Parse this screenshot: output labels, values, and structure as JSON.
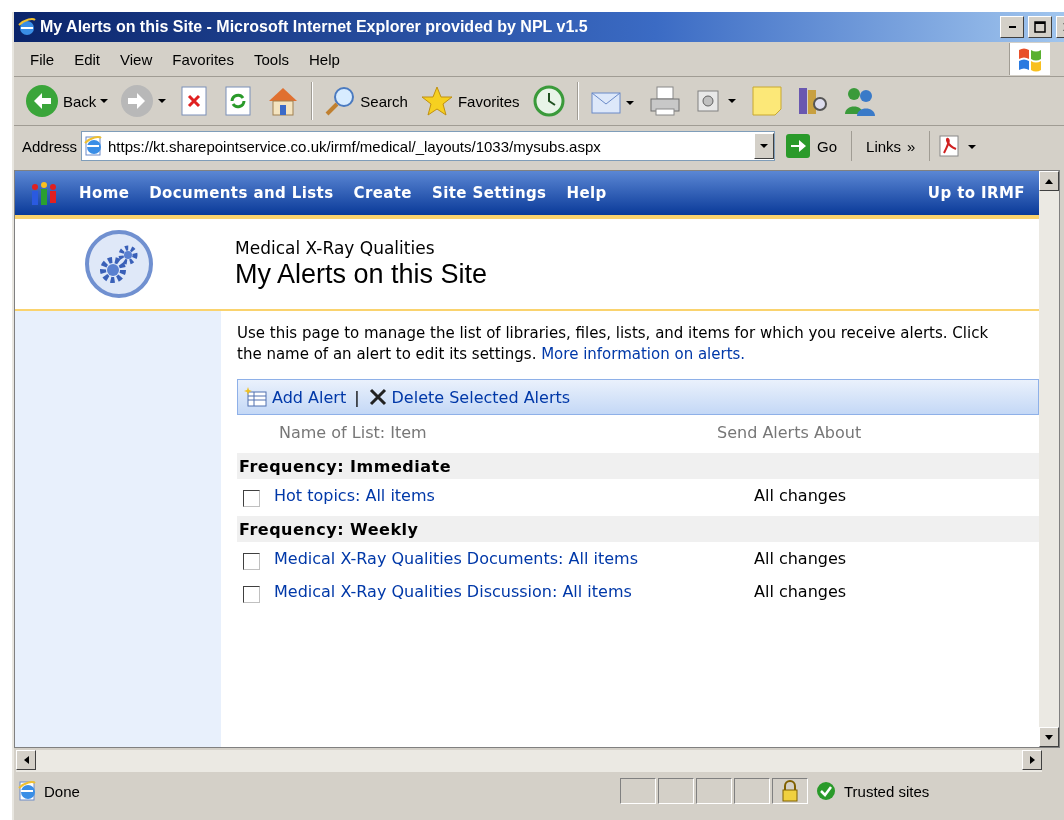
{
  "window": {
    "title": "My Alerts on this Site - Microsoft Internet Explorer provided by NPL v1.5"
  },
  "menu": [
    "File",
    "Edit",
    "View",
    "Favorites",
    "Tools",
    "Help"
  ],
  "toolbar": [
    {
      "kind": "back",
      "label": "Back"
    },
    {
      "kind": "forward"
    },
    {
      "kind": "stop"
    },
    {
      "kind": "refresh"
    },
    {
      "kind": "home"
    },
    {
      "kind": "search",
      "label": "Search"
    },
    {
      "kind": "favorites",
      "label": "Favorites"
    },
    {
      "kind": "history"
    },
    {
      "kind": "mail"
    },
    {
      "kind": "print"
    },
    {
      "kind": "edit"
    },
    {
      "kind": "note"
    },
    {
      "kind": "research"
    },
    {
      "kind": "messenger"
    }
  ],
  "address": {
    "label": "Address",
    "value": "https://kt.sharepointservice.co.uk/irmf/medical/_layouts/1033/mysubs.aspx",
    "go": "Go",
    "links": "Links",
    "chevron": "»"
  },
  "nav": {
    "items": [
      "Home",
      "Documents and Lists",
      "Create",
      "Site Settings",
      "Help"
    ],
    "right": "Up to IRMF"
  },
  "header": {
    "site": "Medical X-Ray Qualities",
    "title": "My Alerts on this Site"
  },
  "intro": {
    "text": "Use this page to manage the list of libraries, files, lists, and items for which you receive alerts. Click the name of an alert to edit its settings.",
    "link": "More information on alerts."
  },
  "actions": [
    {
      "kind": "add",
      "label": "Add Alert"
    },
    {
      "kind": "delete",
      "label": "Delete Selected Alerts"
    }
  ],
  "action_separator": "|",
  "columns": [
    "Name of List: Item",
    "Send Alerts About"
  ],
  "groups": [
    {
      "title": "Frequency: Immediate",
      "alerts": [
        {
          "name": "Hot topics: All items",
          "about": "All changes",
          "checked": false
        }
      ]
    },
    {
      "title": "Frequency: Weekly",
      "alerts": [
        {
          "name": "Medical X-Ray Qualities Documents: All items",
          "about": "All changes",
          "checked": false
        },
        {
          "name": "Medical X-Ray Qualities Discussion: All items",
          "about": "All changes",
          "checked": false
        }
      ]
    }
  ],
  "status_bar": {
    "text": "Done",
    "zone": "Trusted sites"
  }
}
